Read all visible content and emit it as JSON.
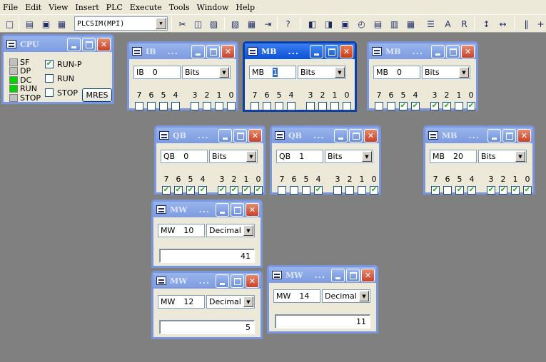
{
  "menu": [
    "File",
    "Edit",
    "View",
    "Insert",
    "PLC",
    "Execute",
    "Tools",
    "Window",
    "Help"
  ],
  "toolbar": {
    "plc_interface": "PLCSIM(MPI)"
  },
  "cpu": {
    "title": "CPU",
    "leds": [
      {
        "label": "SF",
        "color": "#c0c0c0"
      },
      {
        "label": "DP",
        "color": "#c0c0c0"
      },
      {
        "label": "DC",
        "color": "#00d400"
      },
      {
        "label": "RUN",
        "color": "#00d400"
      },
      {
        "label": "STOP",
        "color": "#c0c0c0"
      }
    ],
    "modes": [
      {
        "label": "RUN-P",
        "checked": true
      },
      {
        "label": "RUN",
        "checked": false
      },
      {
        "label": "STOP",
        "checked": false
      }
    ],
    "mres_label": "MRES"
  },
  "bit_labels": [
    "7",
    "6",
    "5",
    "4",
    "3",
    "2",
    "1",
    "0"
  ],
  "ellipsis": "...",
  "windows": [
    {
      "id": "ib0",
      "title": "IB",
      "area": "IB",
      "address": "0",
      "format": "Bits",
      "bits": [
        false,
        false,
        false,
        false,
        false,
        false,
        false,
        false
      ]
    },
    {
      "id": "mb1",
      "title": "MB",
      "area": "MB",
      "address": "1",
      "format": "Bits",
      "bits": [
        false,
        false,
        false,
        false,
        false,
        false,
        false,
        false
      ]
    },
    {
      "id": "mb0",
      "title": "MB",
      "area": "MB",
      "address": "0",
      "format": "Bits",
      "bits": [
        false,
        false,
        true,
        true,
        true,
        true,
        false,
        true
      ]
    },
    {
      "id": "qb0",
      "title": "QB",
      "area": "QB",
      "address": "0",
      "format": "Bits",
      "bits": [
        true,
        true,
        true,
        true,
        true,
        true,
        true,
        true
      ]
    },
    {
      "id": "qb1",
      "title": "QB",
      "area": "QB",
      "address": "1",
      "format": "Bits",
      "bits": [
        false,
        false,
        false,
        true,
        false,
        false,
        false,
        true
      ]
    },
    {
      "id": "mb20",
      "title": "MB",
      "area": "MB",
      "address": "20",
      "format": "Bits",
      "bits": [
        true,
        false,
        true,
        true,
        true,
        true,
        true,
        true
      ]
    },
    {
      "id": "mw10",
      "title": "MW",
      "area": "MW",
      "address": "10",
      "format": "Decimal",
      "value": "41"
    },
    {
      "id": "mw12",
      "title": "MW",
      "area": "MW",
      "address": "12",
      "format": "Decimal",
      "value": "5"
    },
    {
      "id": "mw14",
      "title": "MW",
      "area": "MW",
      "address": "14",
      "format": "Decimal",
      "value": "11"
    }
  ]
}
